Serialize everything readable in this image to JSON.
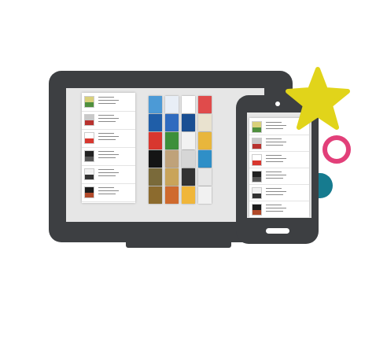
{
  "illustration": {
    "colors": {
      "device": "#3d3f42",
      "screen": "#e6e6e6",
      "star": "#e1d41a",
      "ring": "#e23f79",
      "teal": "#167b8f"
    },
    "icons": [
      "monitor-icon",
      "smartphone-icon",
      "star-icon",
      "ring-icon"
    ],
    "desktop_list": [
      {
        "cover": "#d9d07a",
        "accent": "#4f8f3d"
      },
      {
        "cover": "#c9c9c9",
        "accent": "#b8322e"
      },
      {
        "cover": "#ffffff",
        "accent": "#d8372f"
      },
      {
        "cover": "#222222",
        "accent": "#555555"
      },
      {
        "cover": "#f2f2f2",
        "accent": "#333333"
      },
      {
        "cover": "#1c1c1c",
        "accent": "#b14a2a"
      }
    ],
    "book_grid": [
      "#4c9ad6",
      "#e8eef6",
      "#ffffff",
      "#e04b4b",
      "#1f5ea8",
      "#2f6bbf",
      "#1a4f93",
      "#e9e2cf",
      "#d8372f",
      "#3d8f3b",
      "#f2f2f2",
      "#e8b63c",
      "#141414",
      "#bfa27a",
      "#d6d6d6",
      "#2f8fc7",
      "#7a6a3a",
      "#c9a45a",
      "#333333",
      "#e6e6e6",
      "#8c6b2e",
      "#cf6a2e",
      "#f0b63a",
      "#f1f1f1"
    ],
    "phone_list": [
      {
        "cover": "#d9d07a",
        "accent": "#4f8f3d"
      },
      {
        "cover": "#c9c9c9",
        "accent": "#b8322e"
      },
      {
        "cover": "#ffffff",
        "accent": "#d8372f"
      },
      {
        "cover": "#222222",
        "accent": "#555555"
      },
      {
        "cover": "#f2f2f2",
        "accent": "#333333"
      },
      {
        "cover": "#1c1c1c",
        "accent": "#b14a2a"
      }
    ]
  }
}
